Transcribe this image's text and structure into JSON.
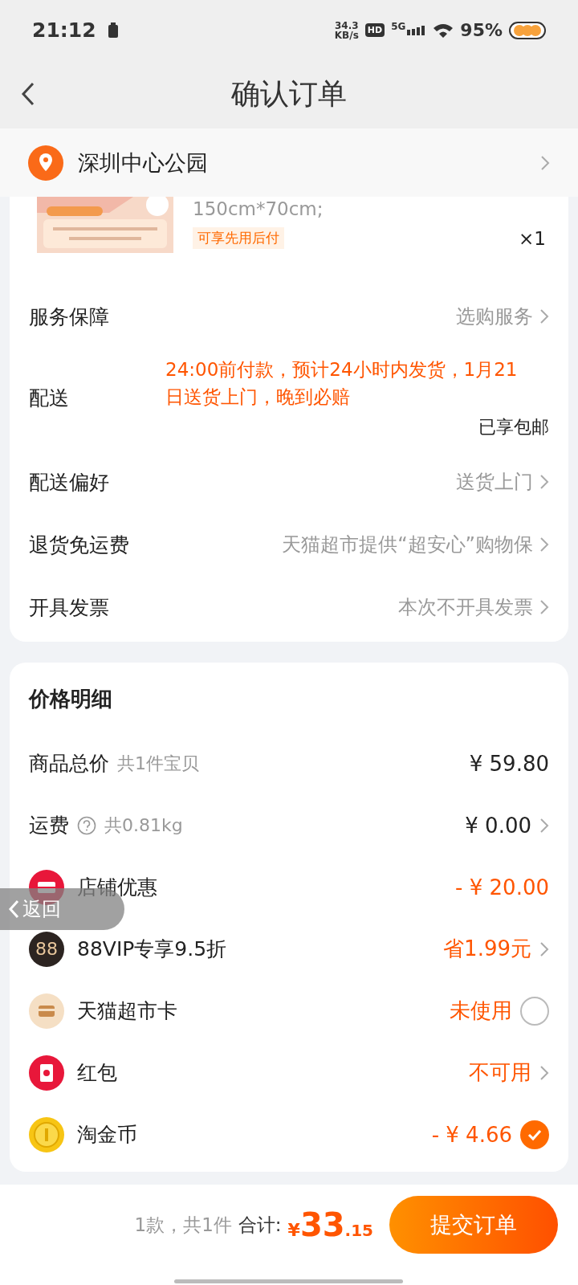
{
  "status_bar": {
    "time": "21:12",
    "net_speed": "34.3",
    "net_unit": "KB/s",
    "hd": "HD",
    "network": "5G",
    "battery": "95%"
  },
  "header": {
    "title": "确认订单"
  },
  "address": {
    "name": "深圳中心公园"
  },
  "product": {
    "kind": "picture",
    "spec": "150cm*70cm;",
    "badge": "可享先用后付",
    "quantity": "×1"
  },
  "order_rows": [
    {
      "kind": "link",
      "label": "服务保障",
      "value": "选购服务"
    },
    {
      "kind": "delivery",
      "label": "配送",
      "value": "24:00前付款，预计24小时内发货，1月21日送货上门，晚到必赔",
      "note": "已享包邮"
    },
    {
      "kind": "link",
      "label": "配送偏好",
      "value": "送货上门"
    },
    {
      "kind": "link",
      "label": "退货免运费",
      "value": "天猫超市提供“超安心”购物保"
    },
    {
      "kind": "link",
      "label": "开具发票",
      "value": "本次不开具发票"
    }
  ],
  "price": {
    "title": "价格明细",
    "rows": [
      {
        "kind": "total",
        "label": "商品总价",
        "sub": "共1件宝贝",
        "value": "¥ 59.80"
      },
      {
        "kind": "shipping",
        "label": "运费",
        "sub": "共0.81kg",
        "value": "¥ 0.00"
      },
      {
        "kind": "coupon",
        "label": "店铺优惠",
        "value": "- ¥ 20.00"
      },
      {
        "kind": "vip",
        "icon_text": "88",
        "label": "88VIP专享9.5折",
        "value": "省1.99元"
      },
      {
        "kind": "card",
        "label": "天猫超市卡",
        "value": "未使用",
        "checked": false
      },
      {
        "kind": "envelope",
        "label": "红包",
        "value": "不可用"
      },
      {
        "kind": "coin",
        "label": "淘金币",
        "value": "- ¥ 4.66",
        "checked": true
      }
    ]
  },
  "footer": {
    "summary": "1款，共1件",
    "total_label": "合计:",
    "currency": "¥",
    "integer": "33",
    "decimals": ".15",
    "button": "提交订单"
  },
  "floating_back": {
    "label": "返回"
  }
}
